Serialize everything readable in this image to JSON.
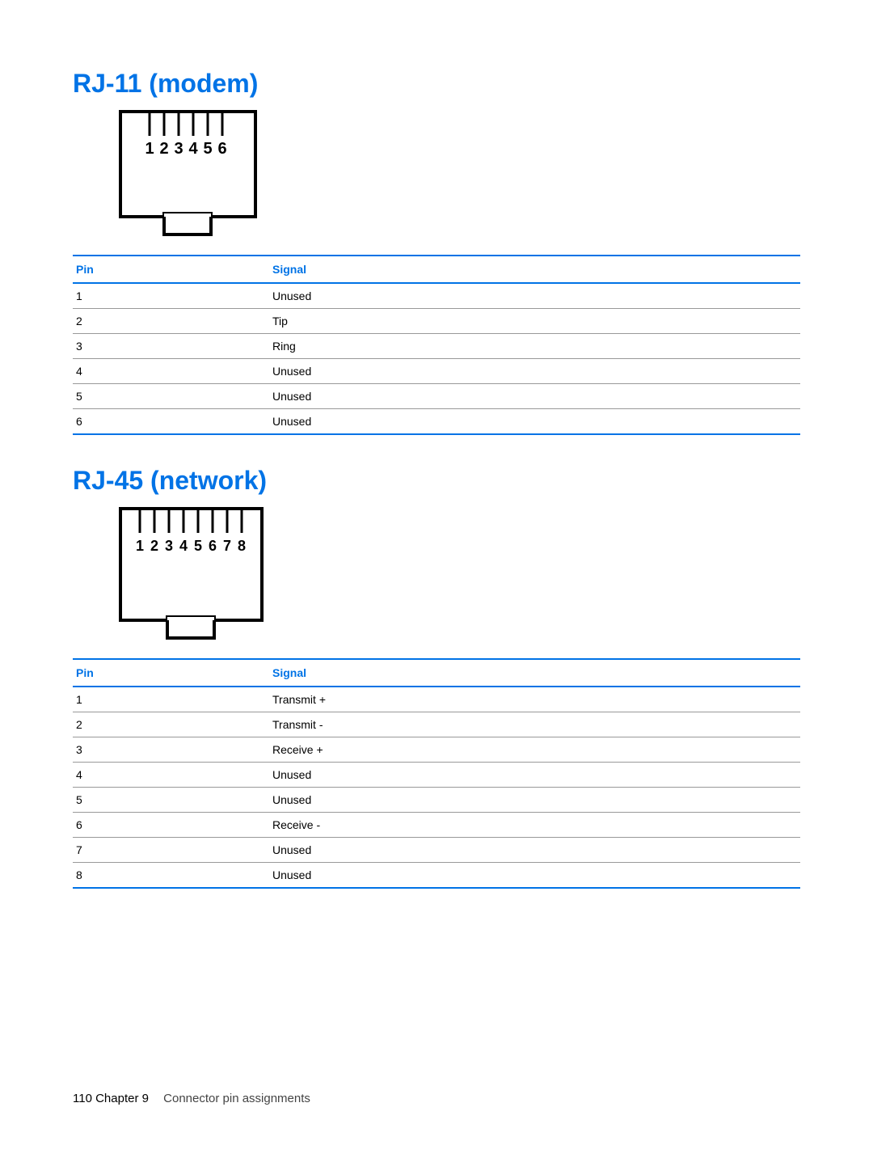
{
  "headings": {
    "rj11": "RJ-11 (modem)",
    "rj45": "RJ-45 (network)"
  },
  "columns": {
    "pin": "Pin",
    "signal": "Signal"
  },
  "rj11_pins": [
    "1",
    "2",
    "3",
    "4",
    "5",
    "6"
  ],
  "rj11_rows": [
    {
      "pin": "1",
      "signal": "Unused"
    },
    {
      "pin": "2",
      "signal": "Tip"
    },
    {
      "pin": "3",
      "signal": "Ring"
    },
    {
      "pin": "4",
      "signal": "Unused"
    },
    {
      "pin": "5",
      "signal": "Unused"
    },
    {
      "pin": "6",
      "signal": "Unused"
    }
  ],
  "rj45_pins": [
    "1",
    "2",
    "3",
    "4",
    "5",
    "6",
    "7",
    "8"
  ],
  "rj45_rows": [
    {
      "pin": "1",
      "signal": "Transmit +"
    },
    {
      "pin": "2",
      "signal": "Transmit -"
    },
    {
      "pin": "3",
      "signal": "Receive +"
    },
    {
      "pin": "4",
      "signal": "Unused"
    },
    {
      "pin": "5",
      "signal": "Unused"
    },
    {
      "pin": "6",
      "signal": "Receive -"
    },
    {
      "pin": "7",
      "signal": "Unused"
    },
    {
      "pin": "8",
      "signal": "Unused"
    }
  ],
  "footer": {
    "page_num": "110",
    "chapter": "Chapter 9",
    "title": "Connector pin assignments"
  }
}
